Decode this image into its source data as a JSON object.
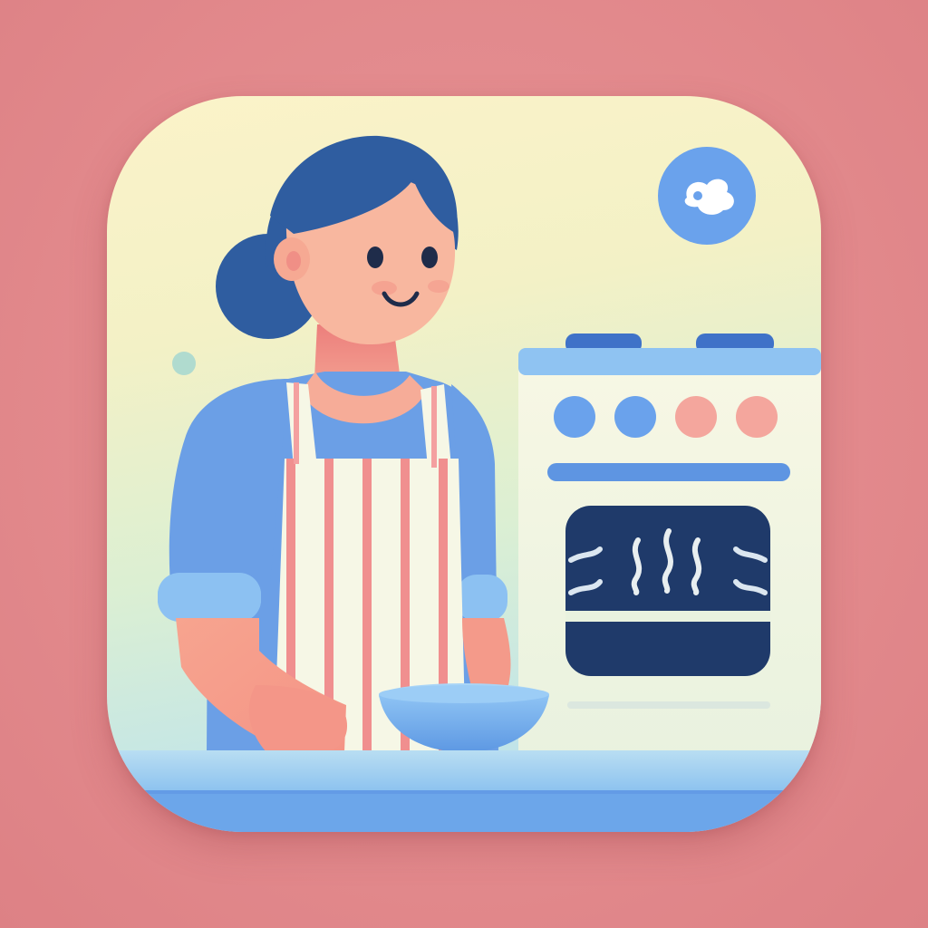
{
  "colors": {
    "background": "#e08a8d",
    "tile_top": "#fbf3c9",
    "tile_bottom": "#b4dcef",
    "hair": "#2f5da0",
    "skin": "#f7b09a",
    "shirt": "#6b9fe6",
    "apron_stripe": "#f08f8f",
    "apron_base": "#f6f7e6",
    "stove_body": "#f4f6e2",
    "stove_top": "#8fc3f2",
    "oven_window": "#1f3a6a",
    "knob_blue": "#6aa2ec",
    "knob_pink": "#f4a69d",
    "counter": "#86baf0",
    "badge": "#6aa2ec"
  },
  "icons": {
    "badge_icon": "cooking-blob-icon",
    "steam_icon": "steam-icon"
  }
}
